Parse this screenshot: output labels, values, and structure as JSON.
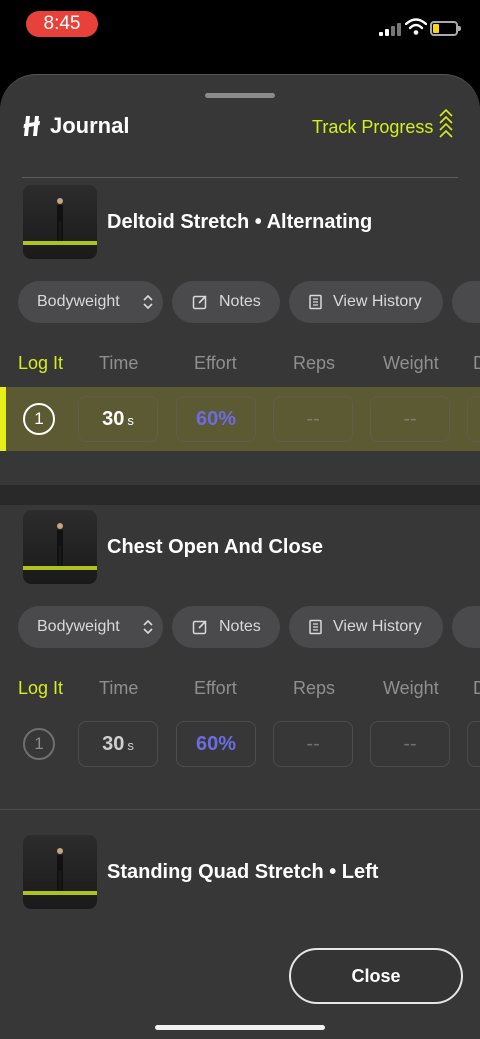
{
  "status_bar": {
    "time": "8:45"
  },
  "header": {
    "title": "Journal",
    "track_progress": "Track Progress"
  },
  "columns": [
    "Log It",
    "Time",
    "Effort",
    "Reps",
    "Weight"
  ],
  "exercises": [
    {
      "title": "Deltoid Stretch • Alternating",
      "pills": {
        "equipment": "Bodyweight",
        "notes": "Notes",
        "history": "View History"
      },
      "set": {
        "number": "1",
        "time": "30",
        "time_unit": "s",
        "effort": "60%",
        "reps": "--",
        "weight": "--"
      }
    },
    {
      "title": "Chest Open And Close",
      "pills": {
        "equipment": "Bodyweight",
        "notes": "Notes",
        "history": "View History"
      },
      "set": {
        "number": "1",
        "time": "30",
        "time_unit": "s",
        "effort": "60%",
        "reps": "--",
        "weight": "--"
      }
    },
    {
      "title": "Standing Quad Stretch • Left"
    }
  ],
  "close_label": "Close",
  "colors": {
    "accent": "#d6ef1a",
    "effort": "#6b6ce0",
    "active_row": "#5c5a33",
    "status_pill": "#e8413a"
  }
}
